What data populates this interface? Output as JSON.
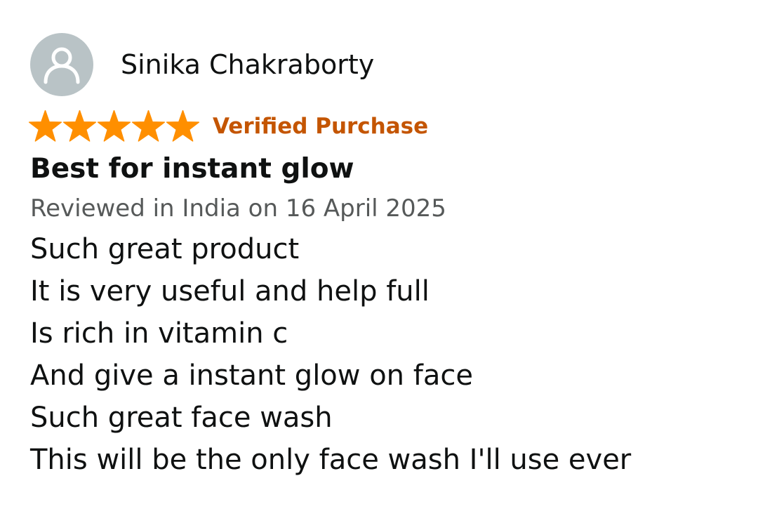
{
  "reviewer": {
    "name": "Sinika Chakraborty",
    "avatar_icon": "default-user-icon"
  },
  "rating": {
    "stars": 5,
    "max_stars": 5,
    "star_color": "#ff8f00",
    "verified_label": "Verified Purchase",
    "verified_color": "#c45500"
  },
  "review": {
    "title": "Best for instant glow",
    "date_line": "Reviewed in India on 16 April 2025",
    "body_lines": [
      "Such great product",
      "It is very useful and help full",
      "Is rich in vitamin c",
      "And give a instant glow on face",
      "Such great face wash",
      "This will be the only face wash I'll use ever"
    ]
  }
}
